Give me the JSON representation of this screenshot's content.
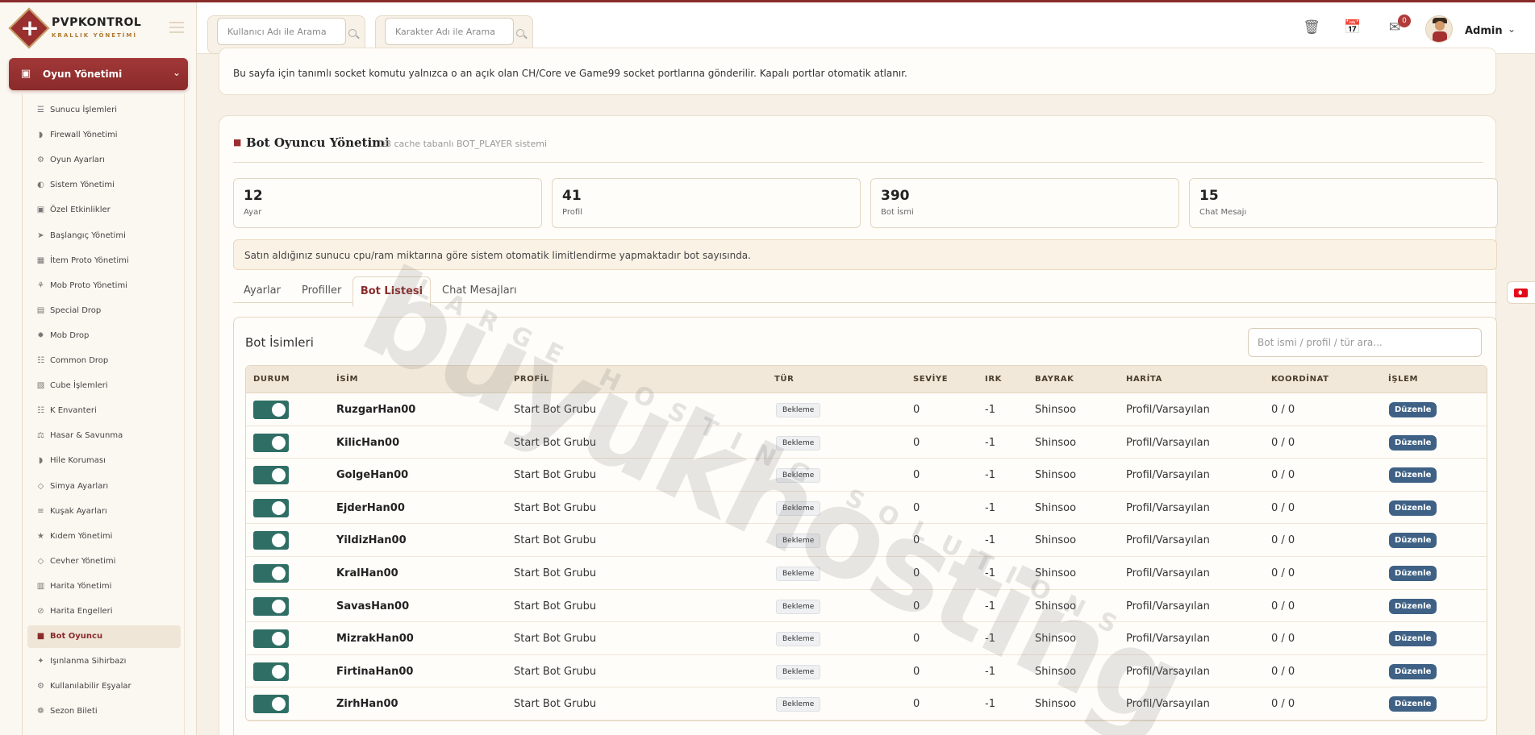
{
  "brand": {
    "name": "PVPKONTROL",
    "sub": "KRALLIK YÖNETİMİ"
  },
  "header": {
    "search_user_placeholder": "Kullanıcı Adı ile Arama",
    "search_char_placeholder": "Karakter Adı ile Arama",
    "mail_badge": "0",
    "admin_name": "Admin"
  },
  "sidebar": {
    "section": "Oyun Yönetimi",
    "items": [
      {
        "label": "Sunucu İşlemleri",
        "icon": "server-icon"
      },
      {
        "label": "Firewall Yönetimi",
        "icon": "shield-icon"
      },
      {
        "label": "Oyun Ayarları",
        "icon": "gears-icon"
      },
      {
        "label": "Sistem Yönetimi",
        "icon": "toggle-icon"
      },
      {
        "label": "Özel Etkinlikler",
        "icon": "gamepad-icon"
      },
      {
        "label": "Başlangıç Yönetimi",
        "icon": "rocket-icon"
      },
      {
        "label": "İtem Proto Yönetimi",
        "icon": "box-icon"
      },
      {
        "label": "Mob Proto Yönetimi",
        "icon": "paw-icon"
      },
      {
        "label": "Special Drop",
        "icon": "gift-icon"
      },
      {
        "label": "Mob Drop",
        "icon": "bug-icon"
      },
      {
        "label": "Common Drop",
        "icon": "table-icon"
      },
      {
        "label": "Cube İşlemleri",
        "icon": "cube-icon"
      },
      {
        "label": "K Envanteri",
        "icon": "grid-icon"
      },
      {
        "label": "Hasar & Savunma",
        "icon": "balance-icon"
      },
      {
        "label": "Hile Koruması",
        "icon": "shield-icon"
      },
      {
        "label": "Simya Ayarları",
        "icon": "gem-icon"
      },
      {
        "label": "Kuşak Ayarları",
        "icon": "sliders-icon"
      },
      {
        "label": "Kıdem Yönetimi",
        "icon": "star-icon"
      },
      {
        "label": "Cevher Yönetimi",
        "icon": "gem-icon"
      },
      {
        "label": "Harita Yönetimi",
        "icon": "map-icon"
      },
      {
        "label": "Harita Engelleri",
        "icon": "ban-icon"
      },
      {
        "label": "Bot Oyuncu",
        "icon": "robot-icon",
        "active": true
      },
      {
        "label": "Işınlanma Sihirbazı",
        "icon": "wand-icon"
      },
      {
        "label": "Kullanılabilir Eşyalar",
        "icon": "gears-icon"
      },
      {
        "label": "Sezon Bileti",
        "icon": "trophy-icon"
      }
    ]
  },
  "info_text": "Bu sayfa için tanımlı socket komutu yalnızca o an açık olan CH/Core ve Game99 socket portlarına gönderilir. Kapalı portlar otomatik atlanır.",
  "panel": {
    "title": "Bot Oyuncu Yönetimi",
    "subtitle": "DB cache tabanlı BOT_PLAYER sistemi",
    "stats": [
      {
        "value": "12",
        "label": "Ayar"
      },
      {
        "value": "41",
        "label": "Profil"
      },
      {
        "value": "390",
        "label": "Bot İsmi"
      },
      {
        "value": "15",
        "label": "Chat Mesajı"
      }
    ],
    "warning": "Satın aldığınız sunucu cpu/ram miktarına göre sistem otomatik limitlendirme yapmaktadır bot sayısında.",
    "tabs": [
      "Ayarlar",
      "Profiller",
      "Bot Listesi",
      "Chat Mesajları"
    ],
    "active_tab": "Bot Listesi"
  },
  "bot_list": {
    "title": "Bot İsimleri",
    "search_placeholder": "Bot ismi / profil / tür ara...",
    "columns": [
      "DURUM",
      "İSİM",
      "PROFİL",
      "TÜR",
      "SEVİYE",
      "IRK",
      "BAYRAK",
      "HARİTA",
      "KOORDİNAT",
      "İŞLEM"
    ],
    "rows": [
      {
        "name": "RuzgarHan00",
        "profile": "Start Bot Grubu",
        "type": "Bekleme",
        "level": "0",
        "race": "-1",
        "flag": "Shinsoo",
        "map": "Profil/Varsayılan",
        "coord": "0 / 0",
        "action": "Düzenle",
        "enabled": true
      },
      {
        "name": "KilicHan00",
        "profile": "Start Bot Grubu",
        "type": "Bekleme",
        "level": "0",
        "race": "-1",
        "flag": "Shinsoo",
        "map": "Profil/Varsayılan",
        "coord": "0 / 0",
        "action": "Düzenle",
        "enabled": true
      },
      {
        "name": "GolgeHan00",
        "profile": "Start Bot Grubu",
        "type": "Bekleme",
        "level": "0",
        "race": "-1",
        "flag": "Shinsoo",
        "map": "Profil/Varsayılan",
        "coord": "0 / 0",
        "action": "Düzenle",
        "enabled": true
      },
      {
        "name": "EjderHan00",
        "profile": "Start Bot Grubu",
        "type": "Bekleme",
        "level": "0",
        "race": "-1",
        "flag": "Shinsoo",
        "map": "Profil/Varsayılan",
        "coord": "0 / 0",
        "action": "Düzenle",
        "enabled": true
      },
      {
        "name": "YildizHan00",
        "profile": "Start Bot Grubu",
        "type": "Bekleme",
        "level": "0",
        "race": "-1",
        "flag": "Shinsoo",
        "map": "Profil/Varsayılan",
        "coord": "0 / 0",
        "action": "Düzenle",
        "enabled": true
      },
      {
        "name": "KralHan00",
        "profile": "Start Bot Grubu",
        "type": "Bekleme",
        "level": "0",
        "race": "-1",
        "flag": "Shinsoo",
        "map": "Profil/Varsayılan",
        "coord": "0 / 0",
        "action": "Düzenle",
        "enabled": true
      },
      {
        "name": "SavasHan00",
        "profile": "Start Bot Grubu",
        "type": "Bekleme",
        "level": "0",
        "race": "-1",
        "flag": "Shinsoo",
        "map": "Profil/Varsayılan",
        "coord": "0 / 0",
        "action": "Düzenle",
        "enabled": true
      },
      {
        "name": "MizrakHan00",
        "profile": "Start Bot Grubu",
        "type": "Bekleme",
        "level": "0",
        "race": "-1",
        "flag": "Shinsoo",
        "map": "Profil/Varsayılan",
        "coord": "0 / 0",
        "action": "Düzenle",
        "enabled": true
      },
      {
        "name": "FirtinaHan00",
        "profile": "Start Bot Grubu",
        "type": "Bekleme",
        "level": "0",
        "race": "-1",
        "flag": "Shinsoo",
        "map": "Profil/Varsayılan",
        "coord": "0 / 0",
        "action": "Düzenle",
        "enabled": true
      },
      {
        "name": "ZirhHan00",
        "profile": "Start Bot Grubu",
        "type": "Bekleme",
        "level": "0",
        "race": "-1",
        "flag": "Shinsoo",
        "map": "Profil/Varsayılan",
        "coord": "0 / 0",
        "action": "Düzenle",
        "enabled": true
      }
    ]
  },
  "watermark": {
    "main": "buyukhosting",
    "sub": "LARGE HOSTING SOLUTIONS"
  },
  "colors": {
    "accent": "#8a2b2b",
    "toggle_on": "#2f6e65",
    "edit_button": "#3e6185",
    "background": "#f6f0e7"
  }
}
